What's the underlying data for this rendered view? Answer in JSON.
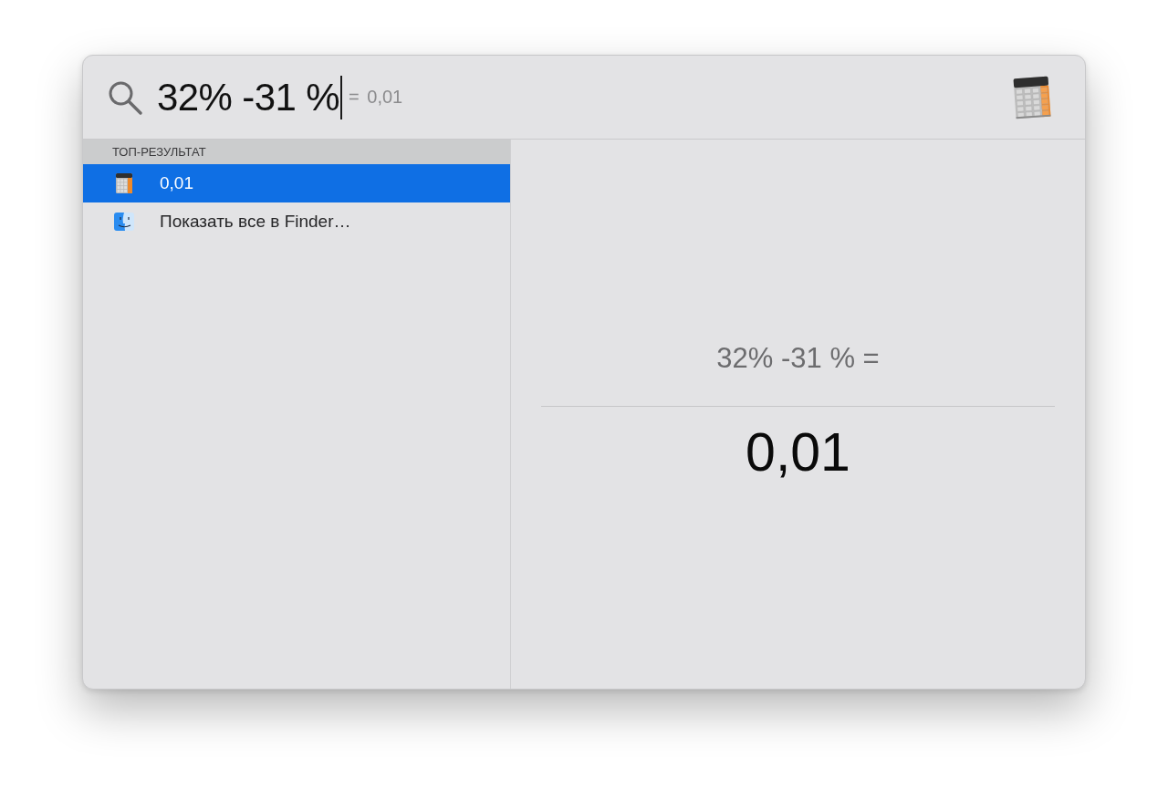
{
  "search": {
    "value": "32% -31 %",
    "completion": "= 0,01",
    "focused": true
  },
  "results": {
    "section_title": "ТОП-РЕЗУЛЬТАТ",
    "items": [
      {
        "kind": "calculator",
        "label": "0,01",
        "selected": true
      },
      {
        "kind": "finder",
        "label": "Показать все в Finder…",
        "selected": false
      }
    ]
  },
  "preview": {
    "expression": "32% -31 % =",
    "result": "0,01"
  }
}
